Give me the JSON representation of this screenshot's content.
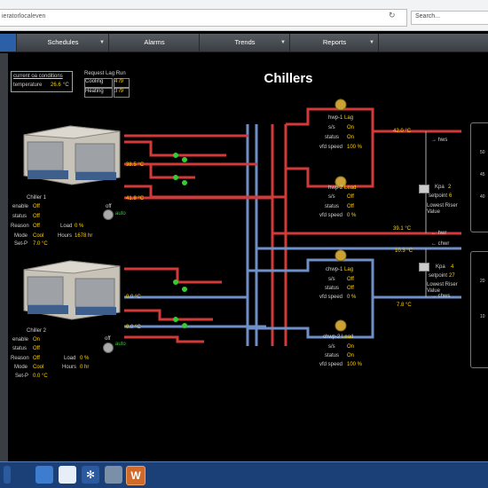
{
  "browser": {
    "url_text": "ieratorlocaleven",
    "reload_glyph": "↻",
    "search_placeholder": "Search..."
  },
  "nav": {
    "items": [
      {
        "label": "Schedules"
      },
      {
        "label": "Alarms"
      },
      {
        "label": "Trends"
      },
      {
        "label": "Reports"
      }
    ]
  },
  "page": {
    "title": "Chillers"
  },
  "oa": {
    "heading": "current oa conditions",
    "temp_label": "temperature",
    "temp_value": "26.6",
    "temp_unit": "°C"
  },
  "lag_run": {
    "heading": "Request Lag Run",
    "cooling_label": "Cooling",
    "cooling_value": "4 /9",
    "heating_label": "Heating",
    "heating_value": "3 /9"
  },
  "chiller1": {
    "name": "Chiller 1",
    "enable_label": "enable",
    "enable_value": "Off",
    "status_label": "status",
    "status_value": "Off",
    "reason_label": "Reason",
    "reason_value": "Off",
    "load_label": "Load",
    "load_value": "0 %",
    "mode_label": "Mode",
    "mode_value": "Cool",
    "hours_label": "Hours",
    "hours_value": "1678 hr",
    "setp_label": "Set-P",
    "setp_value": "7.0 °C",
    "toggle_state": "off",
    "toggle_mode": "auto",
    "temp_a": "38.5 °C",
    "temp_b": "41.8 °C"
  },
  "chiller2": {
    "name": "Chiller 2",
    "enable_label": "enable",
    "enable_value": "On",
    "status_label": "status",
    "status_value": "Off",
    "reason_label": "Reason",
    "reason_value": "Off",
    "load_label": "Load",
    "load_value": "0 %",
    "mode_label": "Mode",
    "mode_value": "Cool",
    "hours_label": "Hours",
    "hours_value": "0 hr",
    "setp_label": "Set-P",
    "setp_value": "0.0 °C",
    "toggle_state": "off",
    "toggle_mode": "auto",
    "temp_a": "0.0 °C",
    "temp_b": "0.0 °C"
  },
  "pumps": {
    "hwp1": {
      "name": "hwp-1",
      "role": "Lag",
      "ss_label": "s/s",
      "ss_value": "On",
      "status_label": "status",
      "status_value": "On",
      "vfd_label": "vfd speed",
      "vfd_value": "100 %"
    },
    "hwp2": {
      "name": "hwp-2",
      "role": "Lead",
      "ss_label": "s/s",
      "ss_value": "Off",
      "status_label": "status",
      "status_value": "Off",
      "vfd_label": "vfd speed",
      "vfd_value": "0 %"
    },
    "chwp1": {
      "name": "chwp-1",
      "role": "Lag",
      "ss_label": "s/s",
      "ss_value": "Off",
      "status_label": "status",
      "status_value": "Off",
      "vfd_label": "vfd speed",
      "vfd_value": "0 %"
    },
    "chwp2": {
      "name": "chwp-2",
      "role": "Lead",
      "ss_label": "s/s",
      "ss_value": "On",
      "status_label": "status",
      "status_value": "On",
      "vfd_label": "vfd speed",
      "vfd_value": "100 %"
    }
  },
  "loops": {
    "hws_temp": "42.0 °C",
    "hws_label": "→ hws",
    "hwr_temp": "39.1 °C",
    "hwr_label": "← hwr",
    "chwr_temp": "10.3 °C",
    "chwr_label": "← chwr",
    "chws_temp": "7.8 °C",
    "chws_label": "→ chws"
  },
  "risers": {
    "hw": {
      "kpa_label": "Kpa",
      "kpa_value": "2",
      "setpoint_label": "setpoint",
      "setpoint_value": "6",
      "caption": "Lowest Riser Value"
    },
    "chw": {
      "kpa_label": "Kpa",
      "kpa_value": "4",
      "setpoint_label": "setpoint",
      "setpoint_value": "27",
      "caption": "Lowest Riser Value"
    }
  },
  "gauge_upper": {
    "ticks": [
      "50",
      "45",
      "40"
    ]
  },
  "gauge_lower": {
    "ticks": [
      "20",
      "10"
    ]
  },
  "taskbar": {
    "app_letter": "W"
  },
  "colors": {
    "hot_pipe": "#d23a3a",
    "cold_pipe": "#6f8fc8",
    "value_yellow": "#ffd100",
    "accent_blue": "#1b3f77"
  }
}
